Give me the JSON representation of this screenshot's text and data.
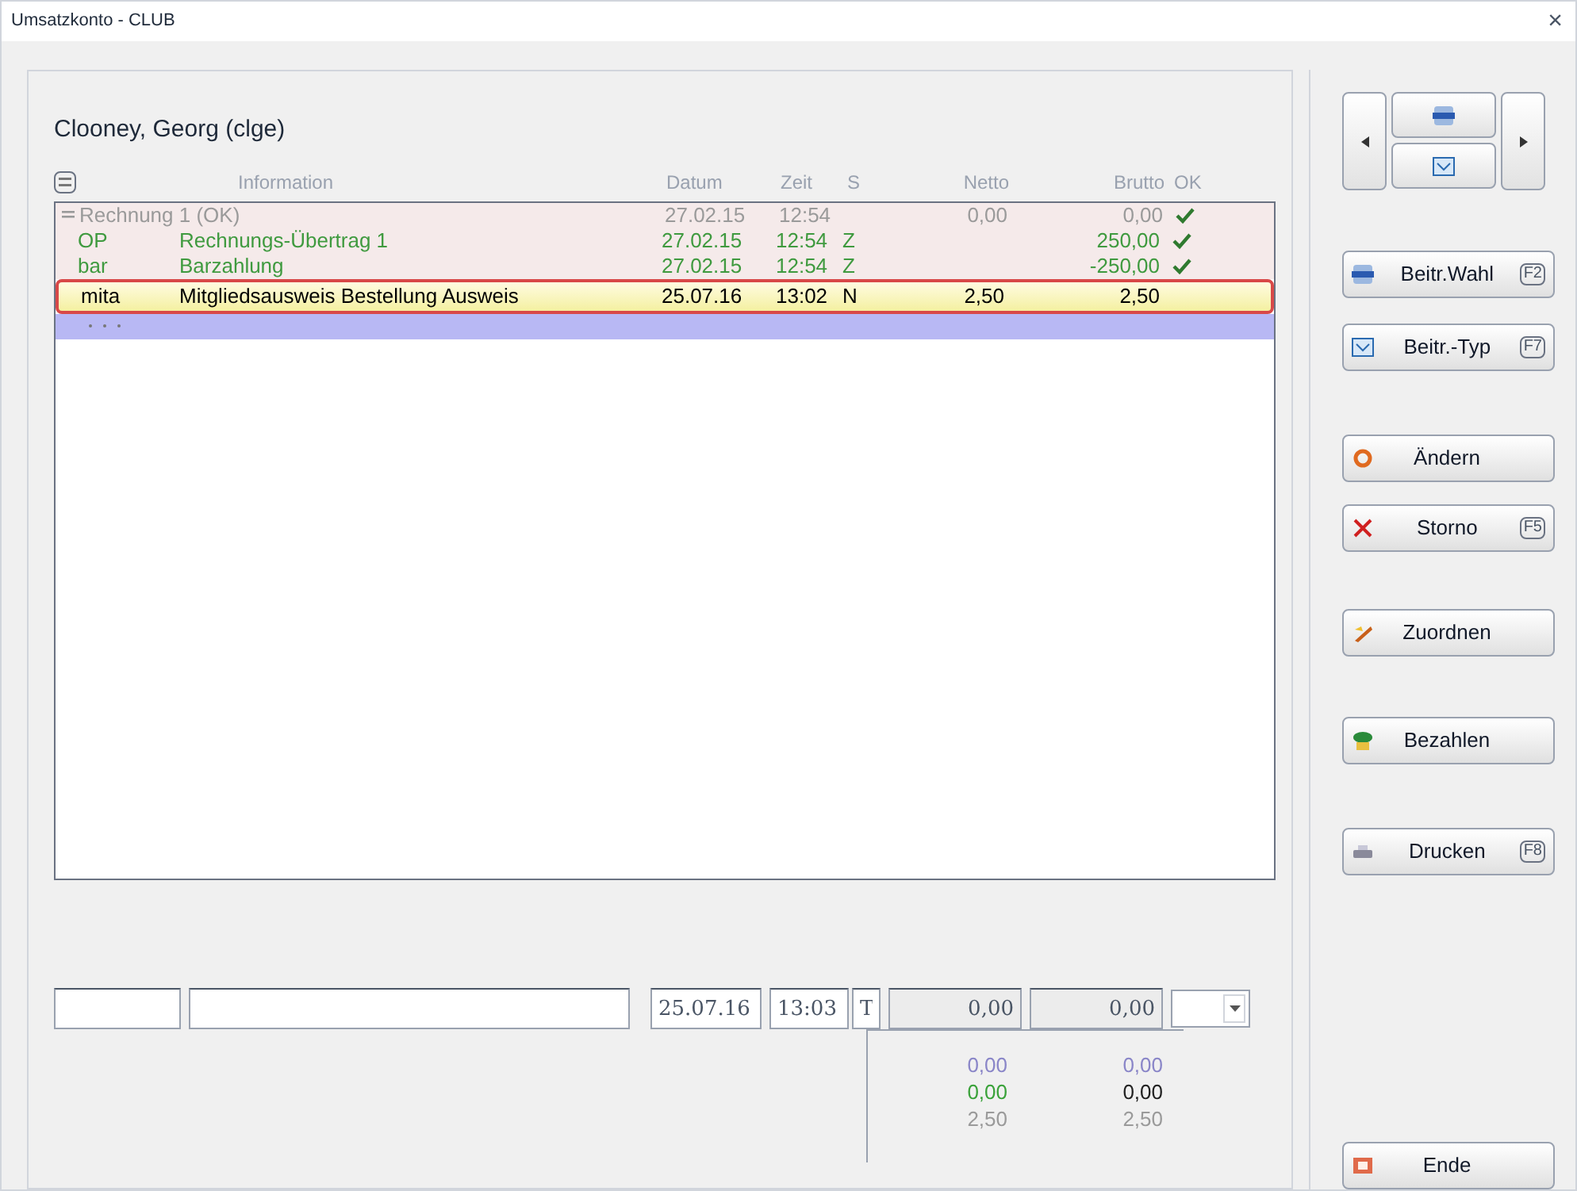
{
  "window": {
    "title": "Umsatzkonto - CLUB",
    "close": "×"
  },
  "member": "Clooney, Georg (clge)",
  "table": {
    "columns": [
      "Information",
      "Datum",
      "Zeit",
      "S",
      "Netto",
      "Brutto",
      "OK"
    ],
    "rows": [
      {
        "kind": "group",
        "expanded": true,
        "selected": false,
        "label": "Rechnung 1 (OK)",
        "datum": "27.02.15",
        "zeit": "12:54",
        "s": "",
        "netto": "0,00",
        "brutto": "0,00",
        "ok": true
      },
      {
        "kind": "entry",
        "selected": false,
        "code": "OP",
        "info": "Rechnungs-Übertrag 1",
        "datum": "27.02.15",
        "zeit": "12:54",
        "s": "Z",
        "netto": "",
        "brutto": "250,00",
        "ok": true
      },
      {
        "kind": "entry",
        "selected": false,
        "code": "bar",
        "info": "Barzahlung",
        "datum": "27.02.15",
        "zeit": "12:54",
        "s": "Z",
        "netto": "",
        "brutto": "-250,00",
        "ok": true
      },
      {
        "kind": "entry",
        "selected": true,
        "code": "mita",
        "info": "Mitgliedsausweis Bestellung Ausweis",
        "datum": "25.07.16",
        "zeit": "13:02",
        "s": "N",
        "netto": "2,50",
        "brutto": "2,50",
        "ok": false
      },
      {
        "kind": "new",
        "selected": false
      }
    ]
  },
  "input_row": {
    "datum": "25.07.16",
    "zeit": "13:03",
    "s": "T",
    "netto": "0,00",
    "brutto": "0,00"
  },
  "totals": [
    {
      "color": "#8a86c8",
      "netto": "0,00",
      "brutto": "0,00"
    },
    {
      "color": "#3aa23a",
      "netto": "0,00",
      "brutto": "0,00"
    },
    {
      "color": "#9a9a9a",
      "netto": "2,50",
      "brutto": "2,50"
    }
  ],
  "buttons": [
    {
      "kind": "wahl",
      "label": "Beitr.Wahl",
      "key": "F2"
    },
    {
      "kind": "typ",
      "label": "Beitr.-Typ",
      "key": "F7"
    },
    {
      "kind": "edit",
      "label": "Ändern"
    },
    {
      "kind": "storno",
      "label": "Storno",
      "key": "F5"
    },
    {
      "kind": "assign",
      "label": "Zuordnen"
    },
    {
      "kind": "pay",
      "label": "Bezahlen"
    },
    {
      "kind": "print",
      "label": "Drucken",
      "key": "F8"
    },
    {
      "kind": "end",
      "label": "Ende"
    }
  ]
}
